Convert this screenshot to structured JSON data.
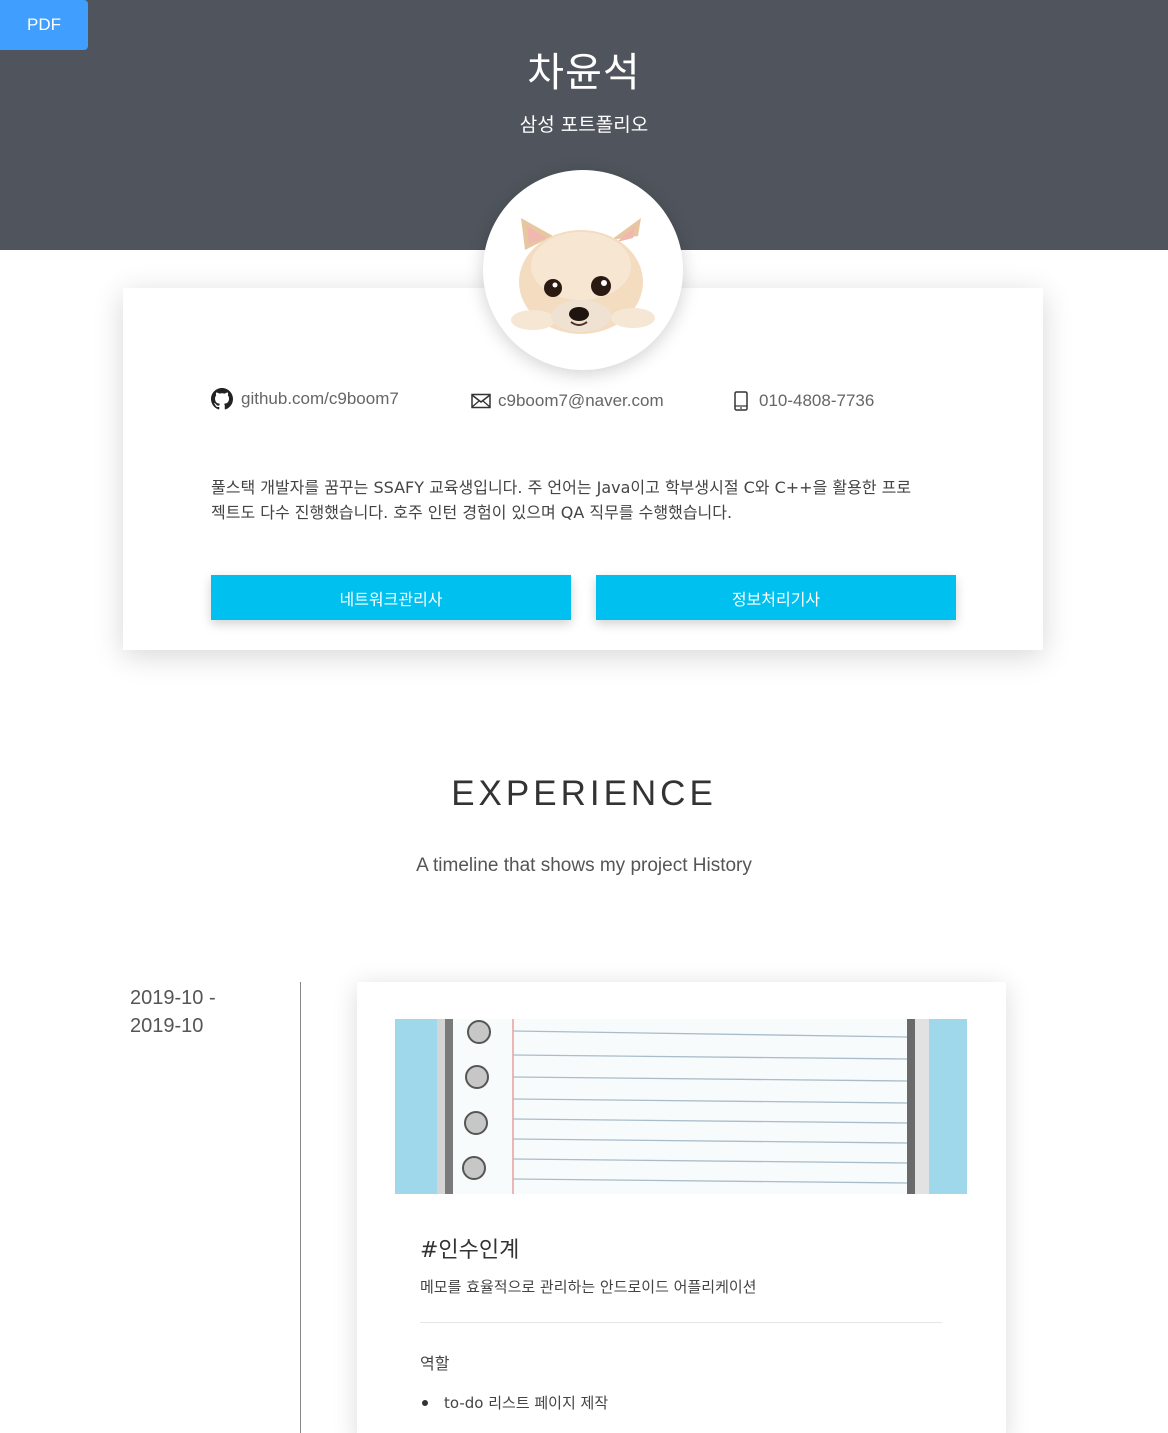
{
  "pdf_button": {
    "label": "PDF"
  },
  "header": {
    "name": "차윤석",
    "subtitle": "삼성 포트폴리오"
  },
  "profile": {
    "contacts": [
      {
        "icon": "github-icon",
        "text": "github.com/c9boom7"
      },
      {
        "icon": "mail-icon",
        "text": "c9boom7@naver.com"
      },
      {
        "icon": "phone-icon",
        "text": "010-4808-7736"
      }
    ],
    "intro_line1": "풀스택 개발자를 꿈꾸는 SSAFY 교육생입니다. 주 언어는 Java이고 학부생시절 C와 C++을 활용한 프로",
    "intro_line2": "젝트도 다수 진행했습니다. 호주 인턴 경험이 있으며 QA 직무를 수행했습니다.",
    "certificates": [
      "네트워크관리사",
      "정보처리기사"
    ]
  },
  "experience": {
    "title": "EXPERIENCE",
    "subtitle": "A timeline that shows my project History",
    "items": [
      {
        "date_start": "2019-10 -",
        "date_end": "2019-10",
        "title": "#인수인계",
        "description": "메모를 효율적으로 관리하는 안드로이드 어플리케이션",
        "role_label": "역할",
        "roles": [
          "to-do 리스트 페이지 제작"
        ]
      }
    ]
  },
  "colors": {
    "header_bg": "#50545c",
    "pdf_button": "#409eff",
    "cert_button": "#00c0ef",
    "notebook_side": "#9ed8ea"
  }
}
